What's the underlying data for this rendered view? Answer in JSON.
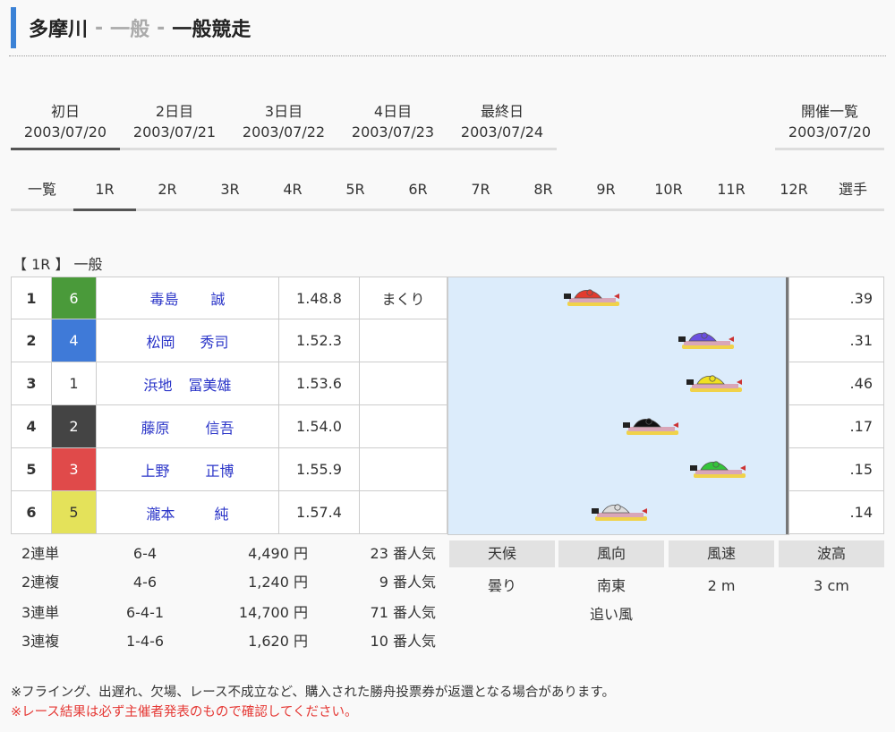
{
  "header": {
    "venue": "多摩川",
    "grade": "一般",
    "race_name": "一般競走",
    "sep": "-"
  },
  "days": [
    {
      "label": "初日",
      "date": "2003/07/20"
    },
    {
      "label": "2日目",
      "date": "2003/07/21"
    },
    {
      "label": "3日目",
      "date": "2003/07/22"
    },
    {
      "label": "4日目",
      "date": "2003/07/23"
    },
    {
      "label": "最終日",
      "date": "2003/07/24"
    },
    {
      "label": "開催一覧",
      "date": "2003/07/20"
    }
  ],
  "race_tabs": [
    "一覧",
    "1R",
    "2R",
    "3R",
    "4R",
    "5R",
    "6R",
    "7R",
    "8R",
    "9R",
    "10R",
    "11R",
    "12R",
    "選手"
  ],
  "race_label": "【 1R 】 一般",
  "results": [
    {
      "rank": "1",
      "boat": "6",
      "family": "毒島",
      "given": "誠",
      "time": "1.48.8",
      "technique": "まくり",
      "st": ".39",
      "color": "#4a9a3a",
      "text_color": "#ffffff"
    },
    {
      "rank": "2",
      "boat": "4",
      "family": "松岡",
      "given": "秀司",
      "time": "1.52.3",
      "technique": "",
      "st": ".31",
      "color": "#3f7ad8",
      "text_color": "#ffffff"
    },
    {
      "rank": "3",
      "boat": "1",
      "family": "浜地",
      "given": "冨美雄",
      "time": "1.53.6",
      "technique": "",
      "st": ".46",
      "color": "#ffffff",
      "text_color": "#333333"
    },
    {
      "rank": "4",
      "boat": "2",
      "family": "藤原",
      "given": "信吾",
      "time": "1.54.0",
      "technique": "",
      "st": ".17",
      "color": "#444444",
      "text_color": "#ffffff"
    },
    {
      "rank": "5",
      "boat": "3",
      "family": "上野",
      "given": "正博",
      "time": "1.55.9",
      "technique": "",
      "st": ".15",
      "color": "#e04a4a",
      "text_color": "#ffffff"
    },
    {
      "rank": "6",
      "boat": "5",
      "family": "瀧本",
      "given": "純",
      "time": "1.57.4",
      "technique": "",
      "st": ".14",
      "color": "#e4e25a",
      "text_color": "#333333"
    }
  ],
  "start_positions": [
    {
      "boat": "1",
      "st": 0.46,
      "body_color": "#e33a2e"
    },
    {
      "boat": "2",
      "st": 0.17,
      "body_color": "#6a4fe0"
    },
    {
      "boat": "3",
      "st": 0.15,
      "body_color": "#f0e020"
    },
    {
      "boat": "4",
      "st": 0.31,
      "body_color": "#111111"
    },
    {
      "boat": "5",
      "st": 0.14,
      "body_color": "#33c43a"
    },
    {
      "boat": "6",
      "st": 0.39,
      "body_color": "#dddddd"
    }
  ],
  "payouts": [
    {
      "type": "2連単",
      "combo": "6-4",
      "amount": "4,490 円",
      "popularity": "23 番人気"
    },
    {
      "type": "2連複",
      "combo": "4-6",
      "amount": "1,240 円",
      "popularity": "9 番人気"
    },
    {
      "type": "3連単",
      "combo": "6-4-1",
      "amount": "14,700 円",
      "popularity": "71 番人気"
    },
    {
      "type": "3連複",
      "combo": "1-4-6",
      "amount": "1,620 円",
      "popularity": "10 番人気"
    }
  ],
  "weather": {
    "headers": [
      "天候",
      "風向",
      "風速",
      "波高"
    ],
    "values": [
      "曇り",
      "南東",
      "2 m",
      "3 cm"
    ],
    "wind_note": "追い風"
  },
  "notes": {
    "line1": "※フライング、出遅れ、欠場、レース不成立など、購入された勝舟投票券が返還となる場合があります。",
    "line2": "※レース結果は必ず主催者発表のもので確認してください。"
  },
  "colors": {
    "accent": "#3b82d6",
    "name_link": "#2a34c8",
    "warning": "#e53935"
  }
}
